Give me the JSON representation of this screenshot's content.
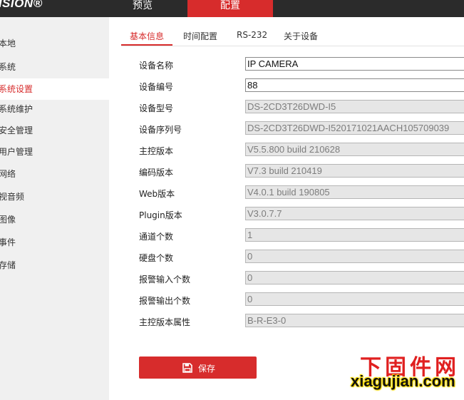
{
  "header": {
    "brand": "VISION®",
    "nav": [
      {
        "label": "预览",
        "active": false
      },
      {
        "label": "配置",
        "active": true
      }
    ]
  },
  "sidebar": {
    "items": [
      {
        "label": "本地",
        "active": false
      },
      {
        "label": "系统",
        "active": false
      },
      {
        "label": "系统设置",
        "active": true
      },
      {
        "label": "系统维护",
        "active": false
      },
      {
        "label": "安全管理",
        "active": false
      },
      {
        "label": "用户管理",
        "active": false
      },
      {
        "label": "网络",
        "active": false
      },
      {
        "label": "视音频",
        "active": false
      },
      {
        "label": "图像",
        "active": false
      },
      {
        "label": "事件",
        "active": false
      },
      {
        "label": "存储",
        "active": false
      }
    ]
  },
  "subtabs": [
    {
      "label": "基本信息",
      "active": true
    },
    {
      "label": "时间配置",
      "active": false
    },
    {
      "label": "RS-232",
      "active": false
    },
    {
      "label": "关于设备",
      "active": false
    }
  ],
  "form": {
    "fields": [
      {
        "label": "设备名称",
        "value": "IP CAMERA",
        "editable": true
      },
      {
        "label": "设备编号",
        "value": "88",
        "editable": true
      },
      {
        "label": "设备型号",
        "value": "DS-2CD3T26DWD-I5",
        "editable": false
      },
      {
        "label": "设备序列号",
        "value": "DS-2CD3T26DWD-I520171021AACH105709039",
        "editable": false
      },
      {
        "label": "主控版本",
        "value": "V5.5.800 build 210628",
        "editable": false
      },
      {
        "label": "编码版本",
        "value": "V7.3 build 210419",
        "editable": false
      },
      {
        "label": "Web版本",
        "value": "V4.0.1 build 190805",
        "editable": false
      },
      {
        "label": "Plugin版本",
        "value": "V3.0.7.7",
        "editable": false
      },
      {
        "label": "通道个数",
        "value": "1",
        "editable": false
      },
      {
        "label": "硬盘个数",
        "value": "0",
        "editable": false
      },
      {
        "label": "报警输入个数",
        "value": "0",
        "editable": false
      },
      {
        "label": "报警输出个数",
        "value": "0",
        "editable": false
      },
      {
        "label": "主控版本属性",
        "value": "B-R-E3-0",
        "editable": false
      }
    ],
    "save_label": "保存",
    "save_icon": "floppy-disk-icon"
  },
  "watermark": {
    "title": "下固件网",
    "url": "xiagujian.com"
  },
  "colors": {
    "accent": "#d72c2c",
    "topbar": "#2b2b2b",
    "sidebar_bg": "#f0f0f0",
    "readonly_field": "#e6e6e6"
  }
}
